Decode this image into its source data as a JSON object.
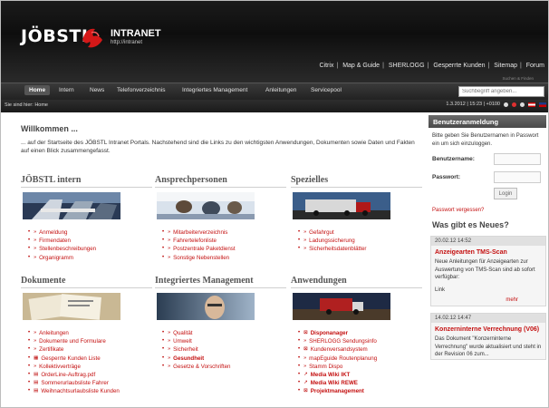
{
  "header": {
    "logo_name": "JÖBSTL",
    "logo_title": "INTRANET",
    "logo_url": "http://intranet",
    "toplinks": [
      "Citrix",
      "Map & Guide",
      "SHERLOGG",
      "Gesperrte Kunden",
      "Sitemap",
      "Forum"
    ]
  },
  "nav": {
    "tabs": [
      "Home",
      "Intern",
      "News",
      "Telefonverzeichnis",
      "Integriertes Management",
      "Anleitungen",
      "Servicepool"
    ],
    "search_placeholder": "Suchbegriff angeben...",
    "search_tip": "Suchen & Finden"
  },
  "crumb": {
    "text": "Sie sind hier: Home",
    "datetime": "1.3.2012 | 15:23 | +0100"
  },
  "welcome": {
    "title": "Willkommen ...",
    "text": "... auf der Startseite des JÖBSTL Intranet Portals. Nachstehend sind die Links zu den wichtigsten Anwendungen, Dokumenten sowie Daten und Fakten auf einen Blick zusammengefasst."
  },
  "sections": {
    "intern": {
      "title": "JÖBSTL intern",
      "items": [
        "Anmeldung",
        "Firmendaten",
        "Stellenbeschreibungen",
        "Organigramm"
      ]
    },
    "ansprech": {
      "title": "Ansprechpersonen",
      "items": [
        "Mitarbeiterverzeichnis",
        "Fahrertelefonliste",
        "Postzentrale Paketdienst",
        "Sonstige Nebenstellen"
      ]
    },
    "spezielles": {
      "title": "Spezielles",
      "items": [
        "Gefahrgut",
        "Ladungssicherung",
        "Sicherheitsdatenblätter"
      ]
    },
    "dokumente": {
      "title": "Dokumente",
      "items": [
        "Anleitungen",
        "Dokumente und Formulare",
        "Zertifikate",
        "Gesperrte Kunden Liste",
        "Kollektivverträge",
        "OrderLine-Auftrag.pdf",
        "Sommerurlaubsliste Fahrer",
        "Weihnachtsurlaubsliste Kunden"
      ]
    },
    "im": {
      "title": "Integriertes Management",
      "items": [
        "Qualität",
        "Umwelt",
        "Sicherheit",
        "Gesundheit",
        "Gesetze & Vorschriften"
      ]
    },
    "anwendungen": {
      "title": "Anwendungen",
      "items": [
        "Disponanager",
        "SHERLOGG Sendungsinfo",
        "Kundenversandsystem",
        "mapEguide Routenplanung",
        "Stamm Dispo",
        "Media Wiki IKT",
        "Media Wiki REWE",
        "Projektmanagement"
      ]
    }
  },
  "sidebar": {
    "login_title": "Benutzeranmeldung",
    "login_text": "Bitte geben Sie Benutzernamen in Passwort ein um sich einzuloggen.",
    "username_label": "Benutzername:",
    "password_label": "Passwort:",
    "login_button": "Login",
    "pw_link": "Passwort vergessen?",
    "news_title": "Was gibt es Neues?",
    "news": [
      {
        "date": "20.02.12 14:52",
        "headline": "Anzeigearten TMS-Scan",
        "body": "Neue Anleitungen für Anzeigearten zur Auswertung von TMS-Scan sind ab sofort verfügbar:",
        "extra": "Link",
        "more": "mehr"
      },
      {
        "date": "14.02.12 14:47",
        "headline": "Konzerninterne Verrechnung (V06)",
        "body": "Das Dokument \"Konzerninterne Verrechnung\" wurde aktualisiert und steht in der Revision 06 zum..."
      }
    ]
  },
  "colors": {
    "accent": "#c41010",
    "header_bg": "#111111"
  }
}
